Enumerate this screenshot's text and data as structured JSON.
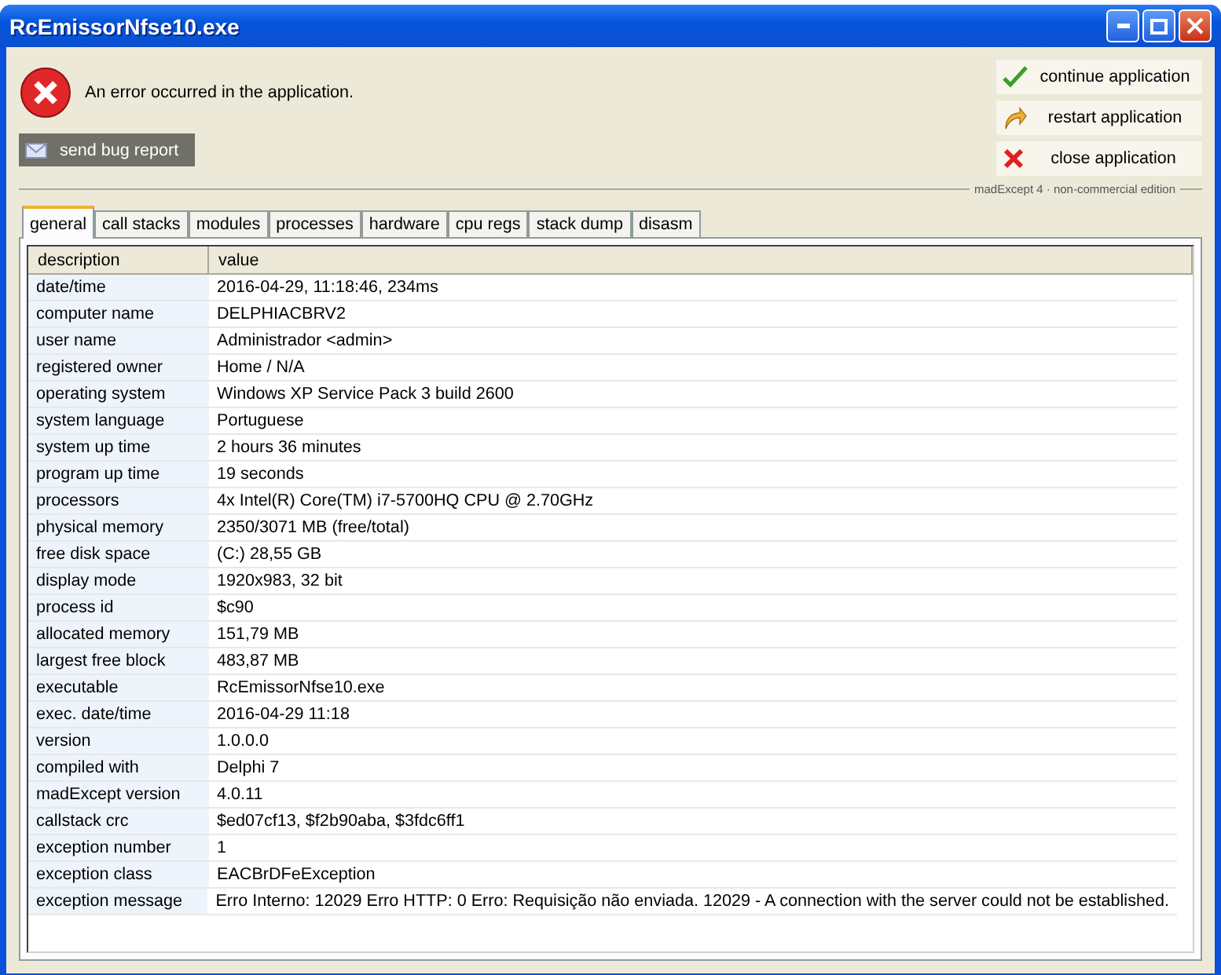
{
  "window": {
    "title": "RcEmissorNfse10.exe"
  },
  "message": "An error occurred in the application.",
  "send_button": "send bug report",
  "actions": [
    {
      "kind": "continue",
      "label": "continue application"
    },
    {
      "kind": "restart",
      "label": "restart application"
    },
    {
      "kind": "close",
      "label": "close application"
    }
  ],
  "edition": "madExcept 4 · non-commercial edition",
  "tabs": [
    {
      "label": "general",
      "selected": true
    },
    {
      "label": "call stacks",
      "selected": false
    },
    {
      "label": "modules",
      "selected": false
    },
    {
      "label": "processes",
      "selected": false
    },
    {
      "label": "hardware",
      "selected": false
    },
    {
      "label": "cpu regs",
      "selected": false
    },
    {
      "label": "stack dump",
      "selected": false
    },
    {
      "label": "disasm",
      "selected": false
    }
  ],
  "table": {
    "columns": [
      "description",
      "value"
    ],
    "rows": [
      [
        "date/time",
        "2016-04-29, 11:18:46, 234ms"
      ],
      [
        "computer name",
        "DELPHIACBRV2"
      ],
      [
        "user name",
        "Administrador  <admin>"
      ],
      [
        "registered owner",
        "Home / N/A"
      ],
      [
        "operating system",
        "Windows XP Service Pack 3 build 2600"
      ],
      [
        "system language",
        "Portuguese"
      ],
      [
        "system up time",
        "2 hours 36 minutes"
      ],
      [
        "program up time",
        "19 seconds"
      ],
      [
        "processors",
        "4x Intel(R) Core(TM) i7-5700HQ CPU @ 2.70GHz"
      ],
      [
        "physical memory",
        "2350/3071 MB (free/total)"
      ],
      [
        "free disk space",
        "(C:) 28,55 GB"
      ],
      [
        "display mode",
        "1920x983, 32 bit"
      ],
      [
        "process id",
        "$c90"
      ],
      [
        "allocated memory",
        "151,79 MB"
      ],
      [
        "largest free block",
        "483,87 MB"
      ],
      [
        "executable",
        "RcEmissorNfse10.exe"
      ],
      [
        "exec. date/time",
        "2016-04-29 11:18"
      ],
      [
        "version",
        "1.0.0.0"
      ],
      [
        "compiled with",
        "Delphi 7"
      ],
      [
        "madExcept version",
        "4.0.11"
      ],
      [
        "callstack crc",
        "$ed07cf13, $f2b90aba, $3fdc6ff1"
      ],
      [
        "exception number",
        "1"
      ],
      [
        "exception class",
        "EACBrDFeException"
      ],
      [
        "exception message",
        "Erro Interno: 12029 Erro HTTP: 0 Erro: Requisição não enviada. 12029 - A connection with the server could not be established."
      ]
    ]
  }
}
